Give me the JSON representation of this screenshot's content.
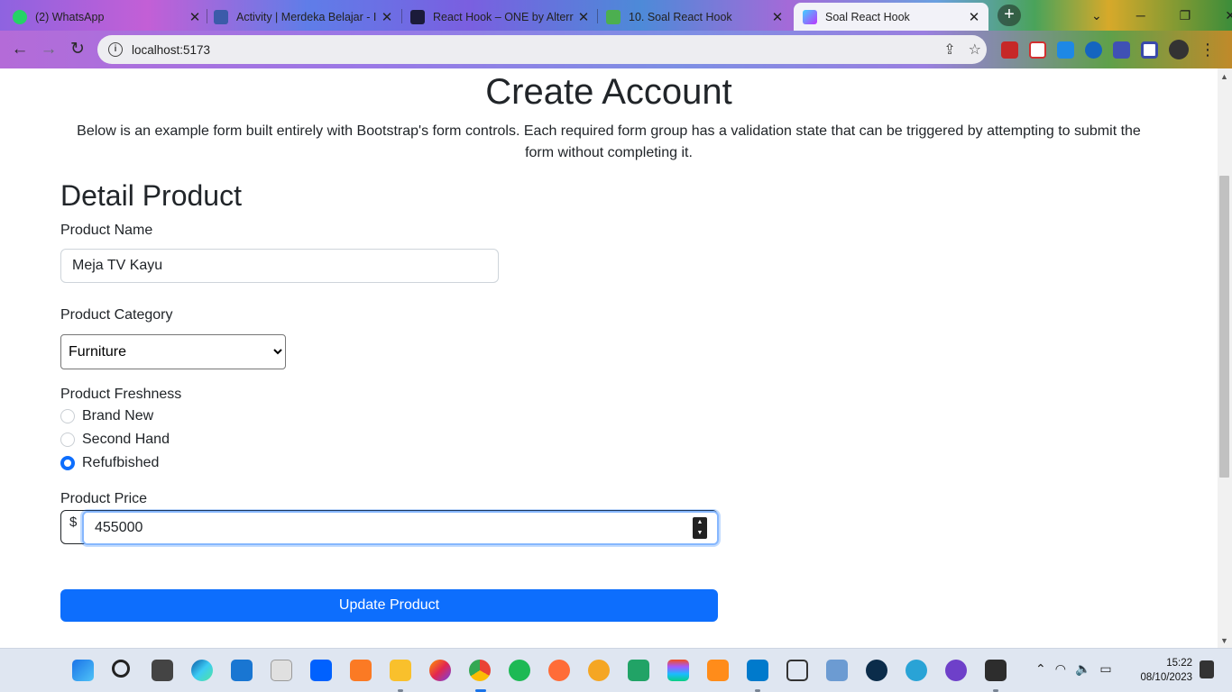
{
  "browser": {
    "tabs": [
      {
        "title": "(2) WhatsApp",
        "icon": "whatsapp-icon",
        "color": "#25d366"
      },
      {
        "title": "Activity | Merdeka Belajar - I",
        "icon": "merdeka-icon",
        "color": "#3b5ba9"
      },
      {
        "title": "React Hook – ONE by Alterr",
        "icon": "one-icon",
        "color": "#1b1b3a"
      },
      {
        "title": "10. Soal React Hook",
        "icon": "book-icon",
        "color": "#4caf50"
      },
      {
        "title": "Soal React Hook",
        "icon": "vite-icon",
        "color": "#a76cf5",
        "active": true
      }
    ],
    "address": "localhost:5173"
  },
  "page": {
    "title": "Create Account",
    "description": "Below is an example form built entirely with Bootstrap's form controls. Each required form group has a validation state that can be triggered by attempting to submit the form without completing it.",
    "section_title": "Detail Product",
    "product_name_label": "Product Name",
    "product_name_value": "Meja TV Kayu",
    "category_label": "Product Category",
    "category_value": "Furniture",
    "freshness_label": "Product Freshness",
    "freshness_options": [
      "Brand New",
      "Second Hand",
      "Refufbished"
    ],
    "freshness_selected": "Refufbished",
    "price_label": "Product Price",
    "price_currency": "$",
    "price_value": "455000",
    "submit_label": "Update Product"
  },
  "taskbar": {
    "time": "15:22",
    "date": "08/10/2023",
    "apps": [
      "windows-start-icon",
      "search-icon",
      "task-view-icon",
      "edge-icon",
      "mail-icon",
      "amazon-icon",
      "dropbox-icon",
      "xampp-icon",
      "file-explorer-icon",
      "firefox-icon",
      "chrome-icon",
      "spotify-icon",
      "postman-icon",
      "pdf-icon",
      "excel-icon",
      "figma-icon",
      "sourcetree-icon",
      "vscode-icon",
      "virtualbox-icon",
      "cube-icon",
      "mongodb-compass-icon",
      "edge-dev-icon",
      "github-desktop-icon",
      "terminal-icon"
    ]
  },
  "colors": {
    "primary": "#0d6efd",
    "text": "#212529"
  }
}
